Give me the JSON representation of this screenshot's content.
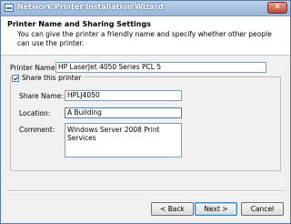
{
  "window": {
    "title": "Network Printer Installation Wizard",
    "close_glyph": "✕"
  },
  "header": {
    "title": "Printer Name and Sharing Settings",
    "description": "You can give the printer a friendly name and specify whether other people can use the printer."
  },
  "form": {
    "printer_name_label": "Printer Name:",
    "printer_name_value": "HP LaserJet 4050 Series PCL 5",
    "share_checkbox_label": "Share this printer",
    "share_checked": true,
    "share_name_label": "Share Name:",
    "share_name_value": "HPLJ4050",
    "location_label": "Location:",
    "location_value": "A Building",
    "comment_label": "Comment:",
    "comment_value": "Windows Server 2008 Print Services"
  },
  "buttons": {
    "back": "< Back",
    "next": "Next >",
    "cancel": "Cancel"
  }
}
